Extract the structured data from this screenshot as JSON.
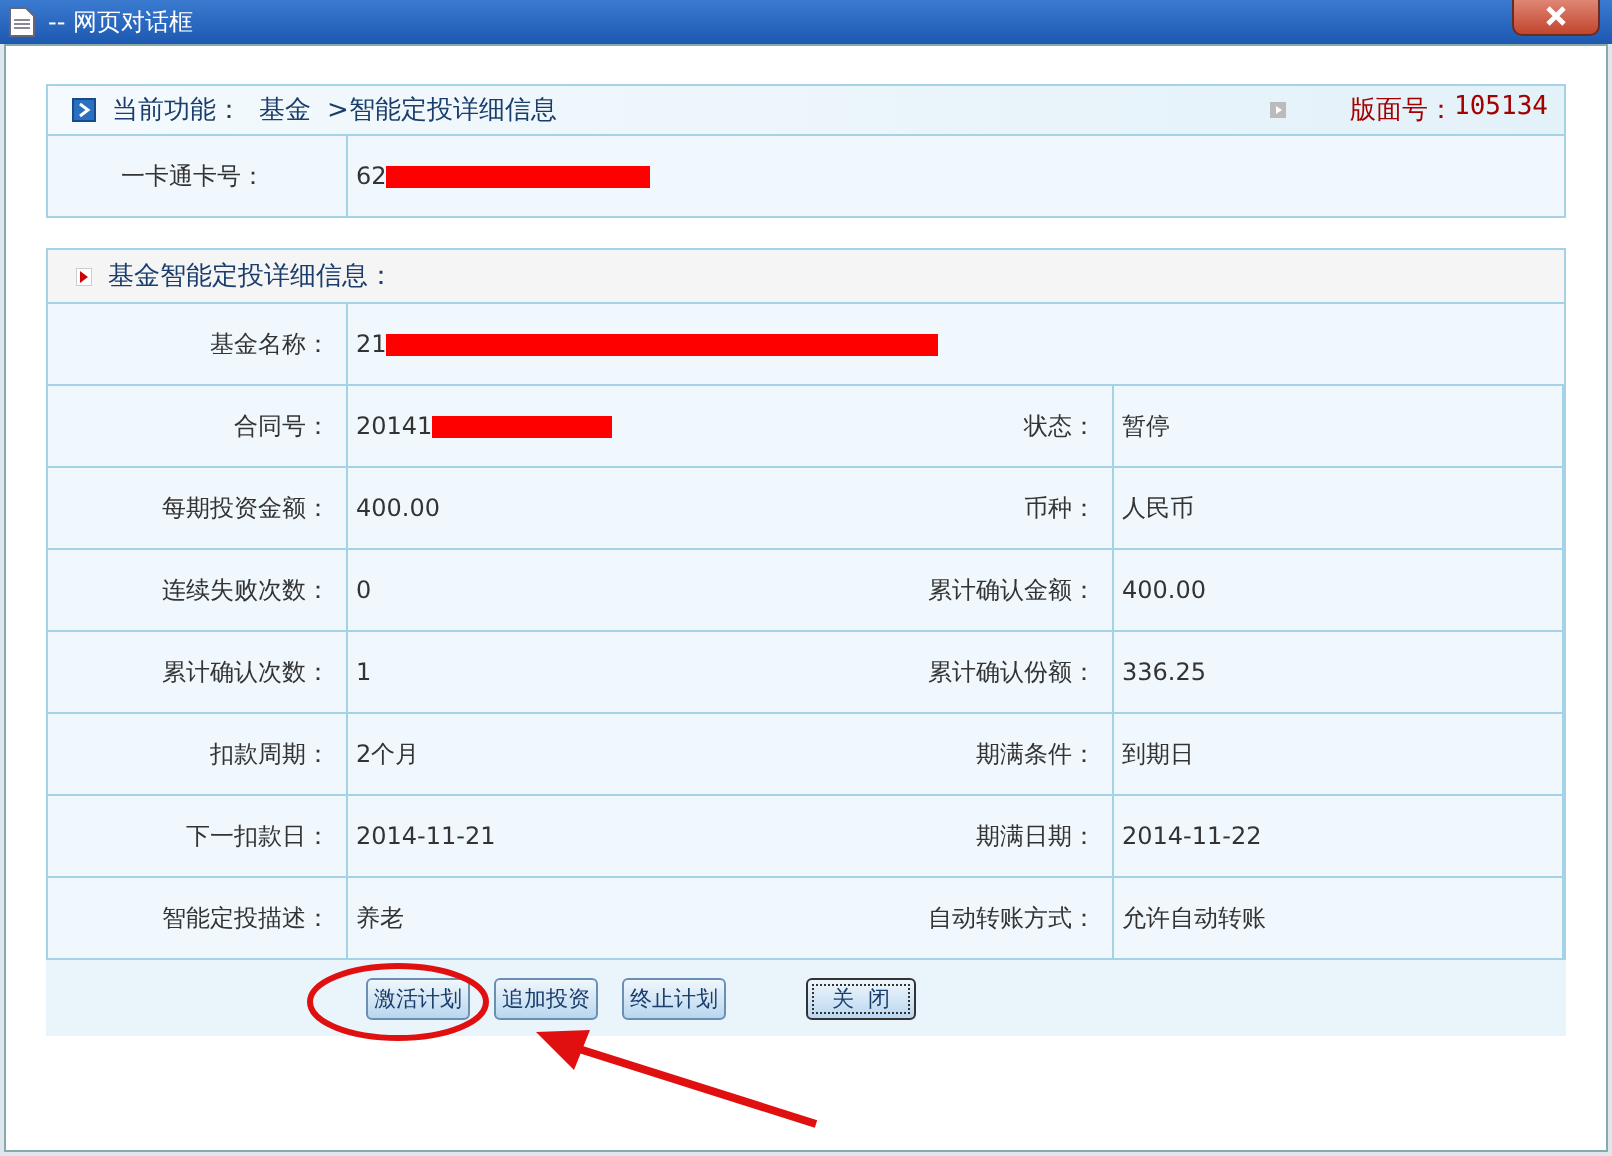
{
  "window": {
    "title": "-- 网页对话框"
  },
  "header": {
    "breadcrumb": "当前功能：  基金  >智能定投详细信息",
    "page_no_label": "版面号：",
    "page_no": "105134"
  },
  "card": {
    "label": "一卡通卡号：",
    "value": "62"
  },
  "section": {
    "title": "基金智能定投详细信息："
  },
  "fund_name": {
    "label": "基金名称：",
    "value": "21"
  },
  "rows": [
    {
      "label": "合同号：",
      "value": "20141",
      "redacted": true,
      "label2": "状态：",
      "value2": "暂停"
    },
    {
      "label": "每期投资金额：",
      "value": "400.00",
      "redacted": false,
      "label2": "币种：",
      "value2": "人民币"
    },
    {
      "label": "连续失败次数：",
      "value": "0",
      "redacted": false,
      "label2": "累计确认金额：",
      "value2": "400.00"
    },
    {
      "label": "累计确认次数：",
      "value": "1",
      "redacted": false,
      "label2": "累计确认份额：",
      "value2": "336.25"
    },
    {
      "label": "扣款周期：",
      "value": "2个月",
      "redacted": false,
      "label2": "期满条件：",
      "value2": "到期日"
    },
    {
      "label": "下一扣款日：",
      "value": "2014-11-21",
      "redacted": false,
      "label2": "期满日期：",
      "value2": "2014-11-22"
    },
    {
      "label": "智能定投描述：",
      "value": "养老",
      "redacted": false,
      "label2": "自动转账方式：",
      "value2": "允许自动转账"
    }
  ],
  "buttons": [
    {
      "label": "激活计划",
      "focused": false
    },
    {
      "label": "追加投资",
      "focused": false
    },
    {
      "label": "终止计划",
      "focused": false
    },
    {
      "label": "关  闭",
      "focused": true
    }
  ]
}
